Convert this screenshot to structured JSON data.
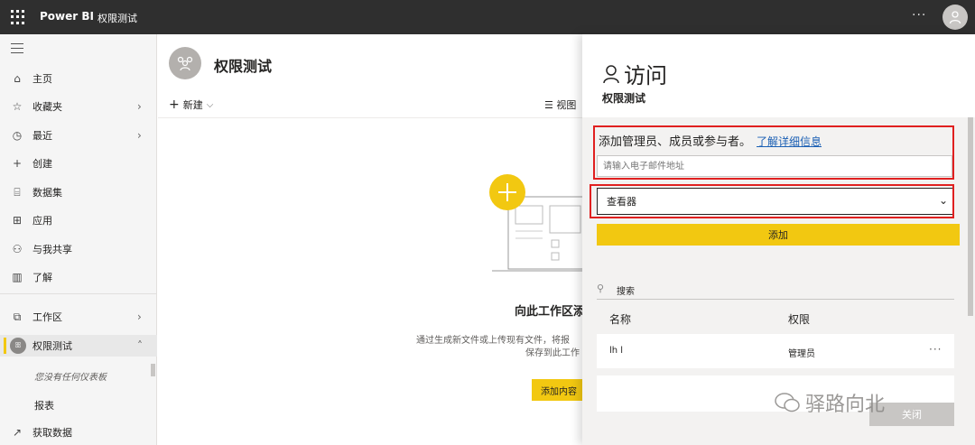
{
  "topbar": {
    "app_name": "Power BI",
    "workspace_title": "权限测试",
    "more_label": "···"
  },
  "sidebar": {
    "items": [
      {
        "label": "主页",
        "icon": "home-icon"
      },
      {
        "label": "收藏夹",
        "icon": "star-icon"
      },
      {
        "label": "最近",
        "icon": "clock-icon"
      },
      {
        "label": "创建",
        "icon": "plus-icon"
      },
      {
        "label": "数据集",
        "icon": "database-icon"
      },
      {
        "label": "应用",
        "icon": "apps-icon"
      },
      {
        "label": "与我共享",
        "icon": "share-icon"
      },
      {
        "label": "了解",
        "icon": "book-icon"
      },
      {
        "label": "工作区",
        "icon": "workspaces-icon"
      },
      {
        "label": "权限测试",
        "icon": "workspace-badge"
      }
    ],
    "no_dashboard_text": "您没有任何仪表板",
    "reports_label": "报表",
    "get_data_label": "获取数据"
  },
  "main": {
    "workspace_name": "权限测试",
    "new_label": "新建",
    "view_label": "视图",
    "empty_title": "向此工作区添",
    "empty_desc_line1": "通过生成新文件或上传现有文件，将报",
    "empty_desc_line2": "保存到此工作",
    "add_content_label": "添加内容"
  },
  "panel": {
    "title": "访问",
    "subtitle": "权限测试",
    "invite_text": "添加管理员、成员或参与者。",
    "learn_more": "了解详细信息",
    "email_placeholder": "请输入电子邮件地址",
    "role_value": "查看器",
    "add_label": "添加",
    "search_label": "搜索",
    "columns": {
      "name": "名称",
      "permission": "权限"
    },
    "members": [
      {
        "name": "lh l",
        "permission": "管理员"
      }
    ],
    "close_label": "关闭"
  },
  "watermark": {
    "text": "驿路向北"
  },
  "colors": {
    "accent": "#f2c811",
    "topbar": "#2f2f2f",
    "highlight_box": "#e02020",
    "link": "#1a5fb4"
  }
}
